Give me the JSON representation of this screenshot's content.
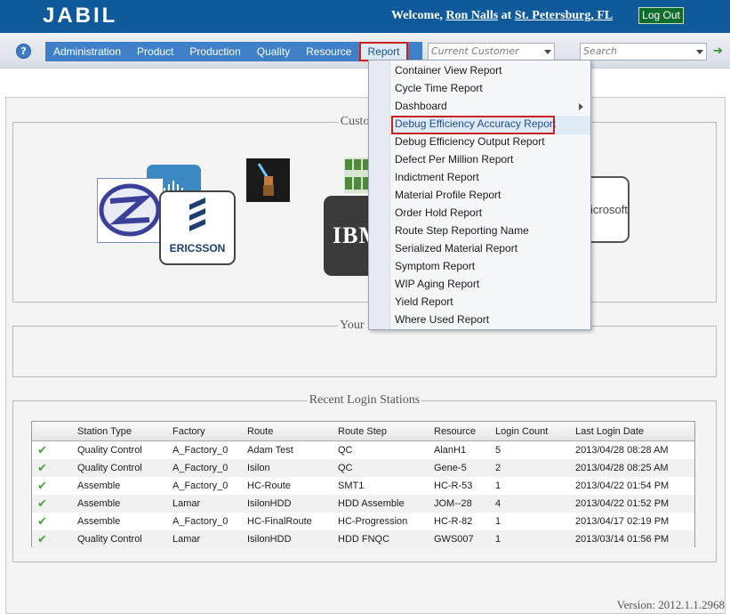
{
  "header": {
    "logo_text": "JABIL",
    "welcome_prefix": "Welcome,",
    "user_name": "Ron Nalls",
    "at_text": "at",
    "site": "St. Petersburg, FL",
    "logout_label": "Log Out"
  },
  "toolbar": {
    "help_label": "?",
    "menu": [
      "Administration",
      "Product",
      "Production",
      "Quality",
      "Resource",
      "Report"
    ],
    "active_menu": "Report",
    "customer_placeholder": "Current Customer",
    "search_placeholder": "Search"
  },
  "report_menu": {
    "items": [
      "Container View Report",
      "Cycle Time Report",
      "Dashboard",
      "Debug Efficiency Accuracy Report",
      "Debug Efficiency Output Report",
      "Defect Per Million Report",
      "Indictment Report",
      "Material Profile Report",
      "Order Hold Report",
      "Route Step Reporting Name",
      "Serialized Material Report",
      "Symptom Report",
      "WIP Aging Report",
      "Yield Report",
      "Where Used Report"
    ],
    "highlighted": "Debug Efficiency Accuracy Report"
  },
  "customer_panel": {
    "legend": "Customer",
    "logos": {
      "ericsson": "ERICSSON",
      "ibm": "IBM",
      "microsoft": "icrosoft"
    }
  },
  "notifications_panel": {
    "legend": "Your Noti"
  },
  "login_panel": {
    "legend": "Recent Login Stations",
    "columns": [
      "Station Type",
      "Factory",
      "Route",
      "Route Step",
      "Resource",
      "Login Count",
      "Last Login Date"
    ],
    "rows": [
      [
        "Quality Control",
        "A_Factory_0",
        "Adam Test",
        "QC",
        "AlanH1",
        "5",
        "2013/04/28 08:28 AM"
      ],
      [
        "Quality Control",
        "A_Factory_0",
        "Isilon",
        "QC",
        "Gene-5",
        "2",
        "2013/04/28 08:25 AM"
      ],
      [
        "Assemble",
        "A_Factory_0",
        "HC-Route",
        "SMT1",
        "HC-R-53",
        "1",
        "2013/04/22 01:54 PM"
      ],
      [
        "Assemble",
        "Lamar",
        "IsilonHDD",
        "HDD Assemble",
        "JOM--28",
        "4",
        "2013/04/22 01:52 PM"
      ],
      [
        "Assemble",
        "A_Factory_0",
        "HC-FinalRoute",
        "HC-Progression",
        "HC-R-82",
        "1",
        "2013/04/17 02:19 PM"
      ],
      [
        "Quality Control",
        "Lamar",
        "IsilonHDD",
        "HDD FNQC",
        "GWS007",
        "1",
        "2013/03/14 01:56 PM"
      ]
    ]
  },
  "footer": {
    "version": "Version: 2012.1.1.2968"
  },
  "colors": {
    "header_blue": "#0e5a9a",
    "menu_blue": "#3f80c8",
    "highlight_red": "#cc1f1f",
    "check_green": "#47a33a"
  }
}
